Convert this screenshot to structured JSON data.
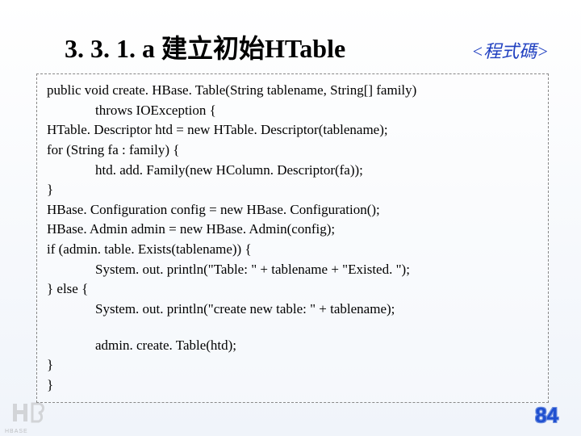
{
  "title": "3. 3. 1. a 建立初始HTable",
  "subtitle": "<程式碼>",
  "code": {
    "l1": "public void create. HBase. Table(String tablename, String[] family)",
    "l2": "throws IOException {",
    "l3": "HTable. Descriptor htd = new HTable. Descriptor(tablename);",
    "l4": "for (String fa : family) {",
    "l5": "htd. add. Family(new HColumn. Descriptor(fa));",
    "l6": "}",
    "l7": "HBase. Configuration config = new HBase. Configuration();",
    "l8": "HBase. Admin admin = new HBase. Admin(config);",
    "l9": "if (admin. table. Exists(tablename)) {",
    "l10": "System. out. println(\"Table: \" + tablename + \"Existed. \");",
    "l11": "} else {",
    "l12": "System. out. println(\"create new table: \" + tablename);",
    "l13": "admin. create. Table(htd);",
    "l14": "}",
    "l15": "}"
  },
  "page_number": "84",
  "logo_text": "HBASE"
}
